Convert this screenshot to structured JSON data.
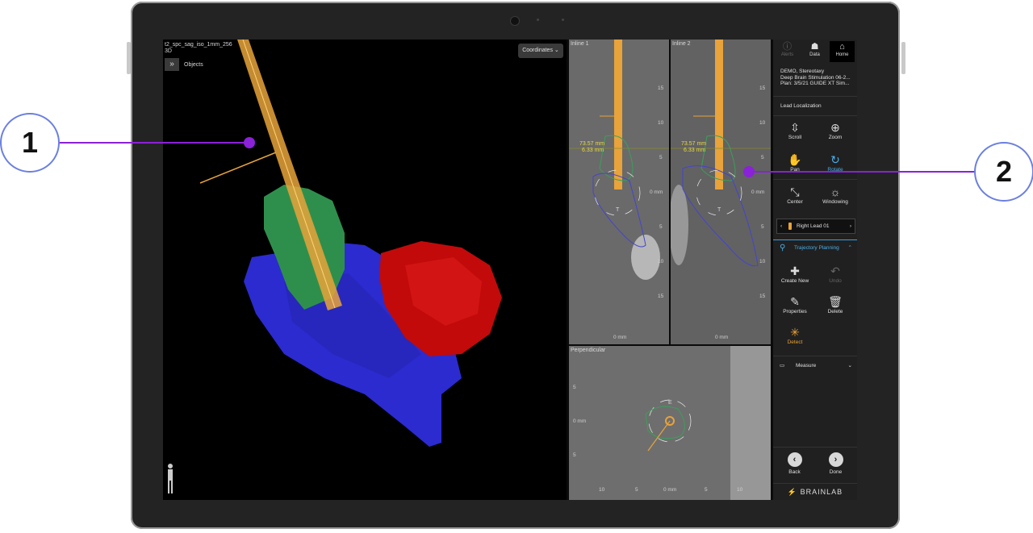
{
  "view3d": {
    "series_name": "t2_spc_sag_iso_1mm_256",
    "mode": "3D",
    "objects_label": "Objects",
    "coordinates_label": "Coordinates"
  },
  "inline1": {
    "title": "Inline 1",
    "distance": "73.57 mm",
    "offset": "6.33 mm",
    "tip_label": "T",
    "bottom": "0 mm",
    "ticks": [
      "15",
      "10",
      "5",
      "0 mm",
      "5",
      "10",
      "15"
    ]
  },
  "inline2": {
    "title": "Inline 2",
    "distance": "73.57 mm",
    "offset": "6.33 mm",
    "tip_label": "T",
    "bottom": "0 mm",
    "ticks": [
      "15",
      "10",
      "5",
      "0 mm",
      "5",
      "10",
      "15"
    ]
  },
  "perp": {
    "title": "Perpendicular",
    "label_e": "E",
    "yticks": [
      "5",
      "0 mm",
      "5"
    ],
    "xticks": [
      "10",
      "5",
      "0 mm",
      "5",
      "10"
    ]
  },
  "panel": {
    "tabs": [
      {
        "label": "Alerts",
        "icon": "alerts-icon",
        "glyph": "ⓘ"
      },
      {
        "label": "Data",
        "icon": "data-icon",
        "glyph": "☗"
      },
      {
        "label": "Home",
        "icon": "home-icon",
        "glyph": "⌂"
      }
    ],
    "info": [
      "DEMO, Stereotaxy",
      "Deep Brain Stimulation 06-2...",
      "Plan: 3/5/21 GUIDE XT Sim..."
    ],
    "section": "Lead Localization",
    "tools": [
      {
        "label": "Scroll",
        "glyph": "⇳"
      },
      {
        "label": "Zoom",
        "glyph": "⊕"
      },
      {
        "label": "Pan",
        "glyph": "✋"
      },
      {
        "label": "Rotate",
        "glyph": "↻"
      },
      {
        "label": "Center",
        "glyph": "⤡"
      },
      {
        "label": "Windowing",
        "glyph": "☼"
      }
    ],
    "lead": "Right Lead 01",
    "trajectory": "Trajectory Planning",
    "tools2": [
      {
        "label": "Create New",
        "glyph": "✚"
      },
      {
        "label": "Undo",
        "glyph": "↶"
      },
      {
        "label": "Properties",
        "glyph": "✎"
      },
      {
        "label": "Delete",
        "glyph": "🗑"
      },
      {
        "label": "Detect",
        "glyph": "✳"
      }
    ],
    "measure": "Measure",
    "back": "Back",
    "done": "Done",
    "brand": "BRAINLAB"
  },
  "callouts": [
    "1",
    "2"
  ],
  "colors": {
    "lead": "#e8a33a",
    "accent": "#39a0e0",
    "purple": "#8a22d8"
  }
}
